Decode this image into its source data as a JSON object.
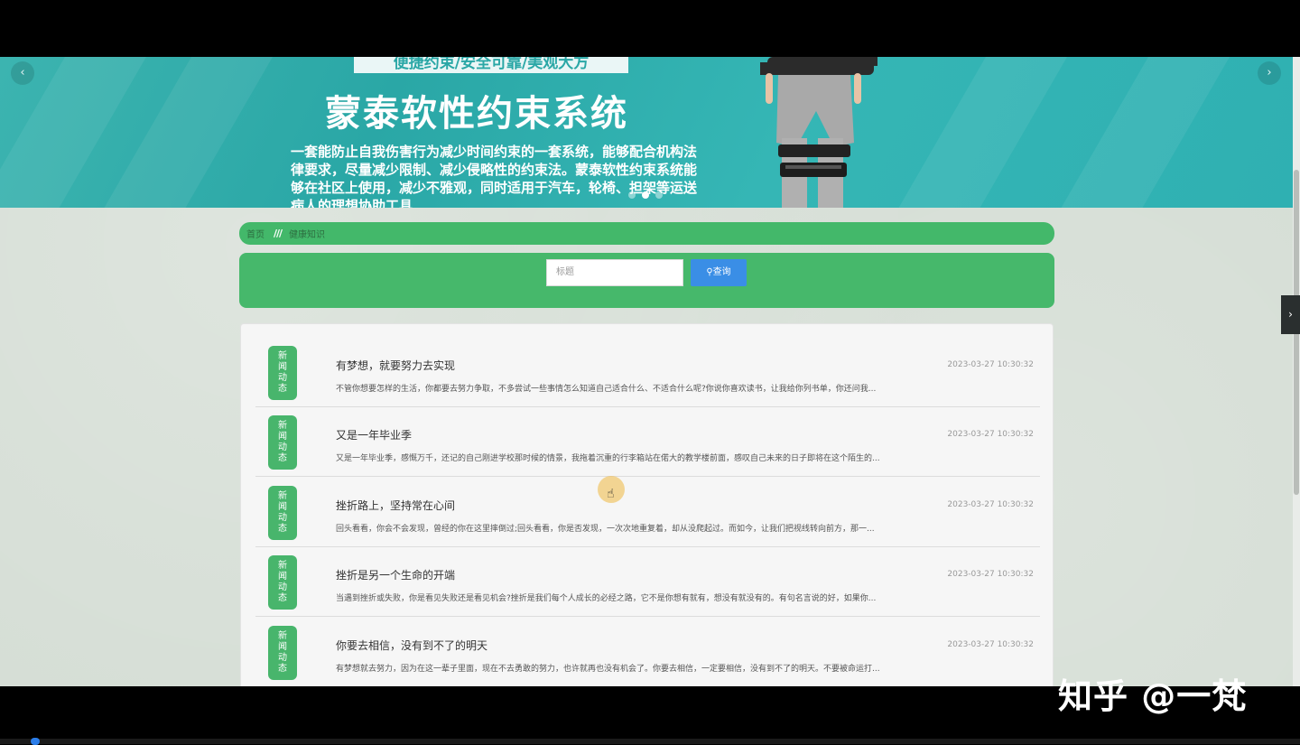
{
  "banner": {
    "tagline": "便捷约束/安全可靠/美观大方",
    "title": "蒙泰软性约束系统",
    "description": "一套能防止自我伤害行为减少时间约束的一套系统，能够配合机构法律要求，尽量减少限制、减少侵略性的约束法。蒙泰软性约束系统能够在社区上使用，减少不雅观，同时适用于汽车，轮椅、担架等运送病人的理想协助工具",
    "prev_icon": "‹",
    "next_icon": "›",
    "slide_count": 3,
    "active_slide": 2
  },
  "side_tab_icon": "›",
  "breadcrumb": {
    "home": "首页",
    "separator": "///",
    "current": "健康知识"
  },
  "search": {
    "placeholder": "标题",
    "button_label": "查询",
    "button_icon": "search-icon"
  },
  "news": {
    "badge": "新闻动态",
    "items": [
      {
        "title": "有梦想，就要努力去实现",
        "date": "2023-03-27 10:30:32",
        "desc": "不管你想要怎样的生活，你都要去努力争取，不多尝试一些事情怎么知道自己适合什么、不适合什么呢?你说你喜欢读书，让我给你列书单，你还问我..."
      },
      {
        "title": "又是一年毕业季",
        "date": "2023-03-27 10:30:32",
        "desc": "又是一年毕业季，感慨万千，还记的自己刚进学校那时候的情景，我拖着沉重的行李箱站在偌大的教学楼前面，感叹自己未来的日子即将在这个陌生的..."
      },
      {
        "title": "挫折路上，坚持常在心间",
        "date": "2023-03-27 10:30:32",
        "desc": "回头看看，你会不会发现，曾经的你在这里摔倒过;回头看看，你是否发现，一次次地重复着，却从没爬起过。而如今，让我们把视线转向前方，那一..."
      },
      {
        "title": "挫折是另一个生命的开端",
        "date": "2023-03-27 10:30:32",
        "desc": "当遇到挫折或失败，你是看见失败还是看见机会?挫折是我们每个人成长的必经之路，它不是你想有就有，想没有就没有的。有句名言说的好，如果你..."
      },
      {
        "title": "你要去相信，没有到不了的明天",
        "date": "2023-03-27 10:30:32",
        "desc": "有梦想就去努力，因为在这一辈子里面，现在不去勇敢的努力，也许就再也没有机会了。你要去相信，一定要相信，没有到不了的明天。不要被命运打..."
      }
    ]
  },
  "watermark": "知乎 @一梵",
  "colors": {
    "banner": "#2aa7a6",
    "green": "#46b86b",
    "button_blue": "#3a8ee6",
    "page_bg": "#d3dcd3"
  }
}
